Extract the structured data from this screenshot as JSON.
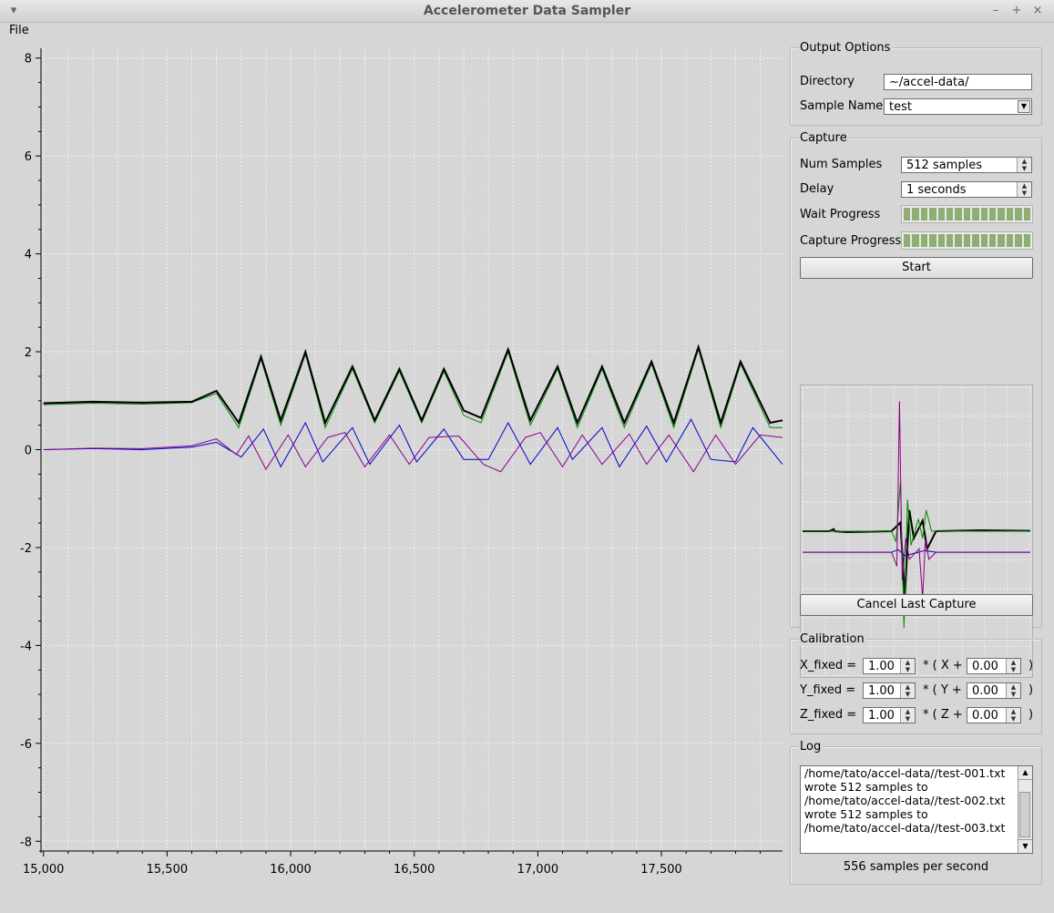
{
  "window": {
    "title": "Accelerometer Data Sampler",
    "controls": [
      "–",
      "+",
      "×"
    ]
  },
  "menu": {
    "file": "File"
  },
  "output": {
    "title": "Output Options",
    "directory_label": "Directory",
    "directory_value": "~/accel-data/",
    "sample_name_label": "Sample Name",
    "sample_name_value": "test"
  },
  "capture": {
    "title": "Capture",
    "num_samples_label": "Num Samples",
    "num_samples_value": "512 samples",
    "delay_label": "Delay",
    "delay_value": "1 seconds",
    "wait_progress_label": "Wait Progress",
    "wait_progress": 1.0,
    "capture_progress_label": "Capture Progress",
    "capture_progress": 1.0,
    "start_label": "Start",
    "cancel_label": "Cancel Last Capture"
  },
  "calibration": {
    "title": "Calibration",
    "rows": [
      {
        "lhs": "X_fixed =",
        "scale": "1.00",
        "mid": "* ( X +",
        "offset": "0.00",
        "close": ")"
      },
      {
        "lhs": "Y_fixed =",
        "scale": "1.00",
        "mid": "* ( Y +",
        "offset": "0.00",
        "close": ")"
      },
      {
        "lhs": "Z_fixed =",
        "scale": "1.00",
        "mid": "* ( Z +",
        "offset": "0.00",
        "close": ")"
      }
    ]
  },
  "log": {
    "title": "Log",
    "lines": [
      "/home/tato/accel-data//test-001.txt",
      "wrote 512 samples to",
      "/home/tato/accel-data//test-002.txt",
      "wrote 512 samples to",
      "/home/tato/accel-data//test-003.txt"
    ],
    "rate": "556 samples per second"
  },
  "chart_data": [
    {
      "type": "line",
      "title": "",
      "xlim": [
        14990,
        17990
      ],
      "ylim": [
        -8.2,
        8.2
      ],
      "x_ticks": [
        "15,000",
        "15,500",
        "16,000",
        "16,500",
        "17,000",
        "17,500"
      ],
      "x_tick_values": [
        15000,
        15500,
        16000,
        16500,
        17000,
        17500
      ],
      "y_ticks": [
        "8",
        "6",
        "4",
        "2",
        "0",
        "-2",
        "-4",
        "-6",
        "-8"
      ],
      "y_tick_values": [
        8,
        6,
        4,
        2,
        0,
        -2,
        -4,
        -6,
        -8
      ],
      "grid": true,
      "series": [
        {
          "color": "#0000cc",
          "x": [
            15000,
            15200,
            15400,
            15600,
            15700,
            15800,
            15890,
            15960,
            16060,
            16130,
            16250,
            16320,
            16440,
            16510,
            16620,
            16700,
            16800,
            16880,
            16970,
            17080,
            17140,
            17260,
            17330,
            17440,
            17520,
            17620,
            17700,
            17800,
            17870,
            17990
          ],
          "y": [
            0.0,
            0.02,
            0.0,
            0.05,
            0.15,
            -0.15,
            0.42,
            -0.35,
            0.55,
            -0.25,
            0.45,
            -0.3,
            0.5,
            -0.25,
            0.42,
            -0.2,
            -0.2,
            0.55,
            -0.3,
            0.45,
            -0.2,
            0.45,
            -0.35,
            0.48,
            -0.25,
            0.62,
            -0.2,
            -0.25,
            0.45,
            -0.3
          ]
        },
        {
          "color": "#880088",
          "x": [
            15000,
            15200,
            15400,
            15600,
            15700,
            15780,
            15830,
            15900,
            15990,
            16060,
            16150,
            16220,
            16300,
            16400,
            16480,
            16560,
            16680,
            16780,
            16850,
            16950,
            17010,
            17100,
            17180,
            17260,
            17370,
            17440,
            17530,
            17630,
            17720,
            17800,
            17900,
            17990
          ],
          "y": [
            0.0,
            0.03,
            0.02,
            0.08,
            0.22,
            -0.1,
            0.28,
            -0.4,
            0.3,
            -0.35,
            0.25,
            0.35,
            -0.35,
            0.3,
            -0.3,
            0.25,
            0.28,
            -0.3,
            -0.45,
            0.25,
            0.35,
            -0.35,
            0.3,
            -0.3,
            0.32,
            -0.3,
            0.3,
            -0.45,
            0.3,
            -0.3,
            0.3,
            0.25
          ]
        },
        {
          "color": "#008800",
          "x": [
            15000,
            15200,
            15400,
            15600,
            15700,
            15790,
            15880,
            15960,
            16060,
            16140,
            16250,
            16340,
            16440,
            16530,
            16620,
            16700,
            16770,
            16880,
            16970,
            17080,
            17160,
            17260,
            17350,
            17460,
            17550,
            17650,
            17740,
            17820,
            17940,
            17990
          ],
          "y": [
            0.92,
            0.95,
            0.93,
            0.96,
            1.15,
            0.45,
            1.85,
            0.5,
            1.95,
            0.45,
            1.65,
            0.55,
            1.6,
            0.55,
            1.6,
            0.7,
            0.55,
            2.0,
            0.5,
            1.65,
            0.45,
            1.65,
            0.45,
            1.75,
            0.45,
            2.05,
            0.45,
            1.75,
            0.45,
            0.45
          ]
        },
        {
          "color": "#000000",
          "x": [
            15000,
            15200,
            15400,
            15600,
            15700,
            15790,
            15880,
            15960,
            16060,
            16140,
            16250,
            16340,
            16440,
            16530,
            16620,
            16700,
            16770,
            16880,
            16970,
            17080,
            17160,
            17260,
            17350,
            17460,
            17550,
            17650,
            17740,
            17820,
            17940,
            17990
          ],
          "y": [
            0.95,
            0.98,
            0.96,
            0.98,
            1.2,
            0.55,
            1.9,
            0.6,
            2.0,
            0.55,
            1.7,
            0.6,
            1.65,
            0.6,
            1.65,
            0.8,
            0.65,
            2.05,
            0.6,
            1.7,
            0.55,
            1.7,
            0.55,
            1.8,
            0.55,
            2.1,
            0.55,
            1.8,
            0.55,
            0.6
          ]
        }
      ]
    },
    {
      "type": "line",
      "title": "",
      "xlim": [
        0,
        512
      ],
      "ylim": [
        -8.2,
        8.2
      ],
      "grid": true,
      "series": [
        {
          "color": "#000000",
          "x": [
            0,
            60,
            70,
            72,
            100,
            200,
            220,
            230,
            240,
            250,
            270,
            280,
            300,
            400,
            512
          ],
          "y": [
            0.0,
            0.0,
            0.12,
            0.0,
            -0.05,
            0.0,
            0.5,
            -3.7,
            1.2,
            -0.4,
            0.6,
            -1.0,
            0.0,
            0.05,
            0.02
          ]
        },
        {
          "color": "#008800",
          "x": [
            0,
            200,
            210,
            220,
            228,
            236,
            244,
            260,
            270,
            278,
            290,
            320,
            512
          ],
          "y": [
            0.0,
            0.0,
            -0.6,
            2.8,
            -5.5,
            1.8,
            -0.8,
            0.7,
            -0.4,
            1.2,
            0.0,
            0.0,
            0.0
          ]
        },
        {
          "color": "#0000cc",
          "x": [
            0,
            200,
            215,
            230,
            260,
            275,
            300,
            512
          ],
          "y": [
            -1.2,
            -1.2,
            -1.05,
            -1.4,
            -1.2,
            -1.1,
            -1.2,
            -1.2
          ]
        },
        {
          "color": "#880088",
          "x": [
            0,
            200,
            212,
            218,
            224,
            232,
            240,
            262,
            270,
            276,
            284,
            300,
            512
          ],
          "y": [
            -1.2,
            -1.2,
            -2.0,
            7.4,
            -2.8,
            -0.4,
            -1.6,
            -1.0,
            -3.8,
            -0.5,
            -1.6,
            -1.2,
            -1.2
          ]
        }
      ]
    }
  ]
}
